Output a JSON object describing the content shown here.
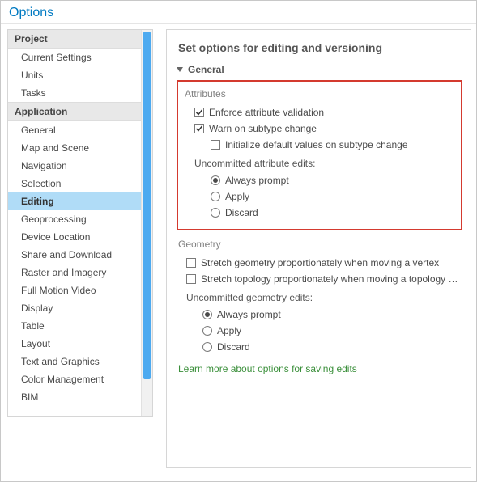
{
  "window": {
    "title": "Options"
  },
  "sidebar": {
    "groups": [
      {
        "header": "Project",
        "items": [
          {
            "label": "Current Settings",
            "selected": false
          },
          {
            "label": "Units",
            "selected": false
          },
          {
            "label": "Tasks",
            "selected": false
          }
        ]
      },
      {
        "header": "Application",
        "items": [
          {
            "label": "General",
            "selected": false
          },
          {
            "label": "Map and Scene",
            "selected": false
          },
          {
            "label": "Navigation",
            "selected": false
          },
          {
            "label": "Selection",
            "selected": false
          },
          {
            "label": "Editing",
            "selected": true
          },
          {
            "label": "Geoprocessing",
            "selected": false
          },
          {
            "label": "Device Location",
            "selected": false
          },
          {
            "label": "Share and Download",
            "selected": false
          },
          {
            "label": "Raster and Imagery",
            "selected": false
          },
          {
            "label": "Full Motion Video",
            "selected": false
          },
          {
            "label": "Display",
            "selected": false
          },
          {
            "label": "Table",
            "selected": false
          },
          {
            "label": "Layout",
            "selected": false
          },
          {
            "label": "Text and Graphics",
            "selected": false
          },
          {
            "label": "Color Management",
            "selected": false
          },
          {
            "label": "BIM",
            "selected": false
          }
        ]
      }
    ]
  },
  "panel": {
    "title": "Set options for editing and versioning",
    "section_general": "General",
    "attributes": {
      "title": "Attributes",
      "enforce": {
        "label": "Enforce attribute validation",
        "checked": true
      },
      "warn": {
        "label": "Warn on subtype change",
        "checked": true
      },
      "init": {
        "label": "Initialize default values on subtype change",
        "checked": false
      },
      "uncommitted_label": "Uncommitted attribute edits:",
      "radios": {
        "always": {
          "label": "Always prompt",
          "selected": true
        },
        "apply": {
          "label": "Apply",
          "selected": false
        },
        "discard": {
          "label": "Discard",
          "selected": false
        }
      }
    },
    "geometry": {
      "title": "Geometry",
      "stretch_vertex": {
        "label": "Stretch geometry proportionately when moving a vertex",
        "checked": false
      },
      "stretch_topology": {
        "label": "Stretch topology proportionately when moving a topology eleme",
        "checked": false
      },
      "uncommitted_label": "Uncommitted geometry edits:",
      "radios": {
        "always": {
          "label": "Always prompt",
          "selected": true
        },
        "apply": {
          "label": "Apply",
          "selected": false
        },
        "discard": {
          "label": "Discard",
          "selected": false
        }
      }
    },
    "learn_more": "Learn more about options for saving edits"
  }
}
